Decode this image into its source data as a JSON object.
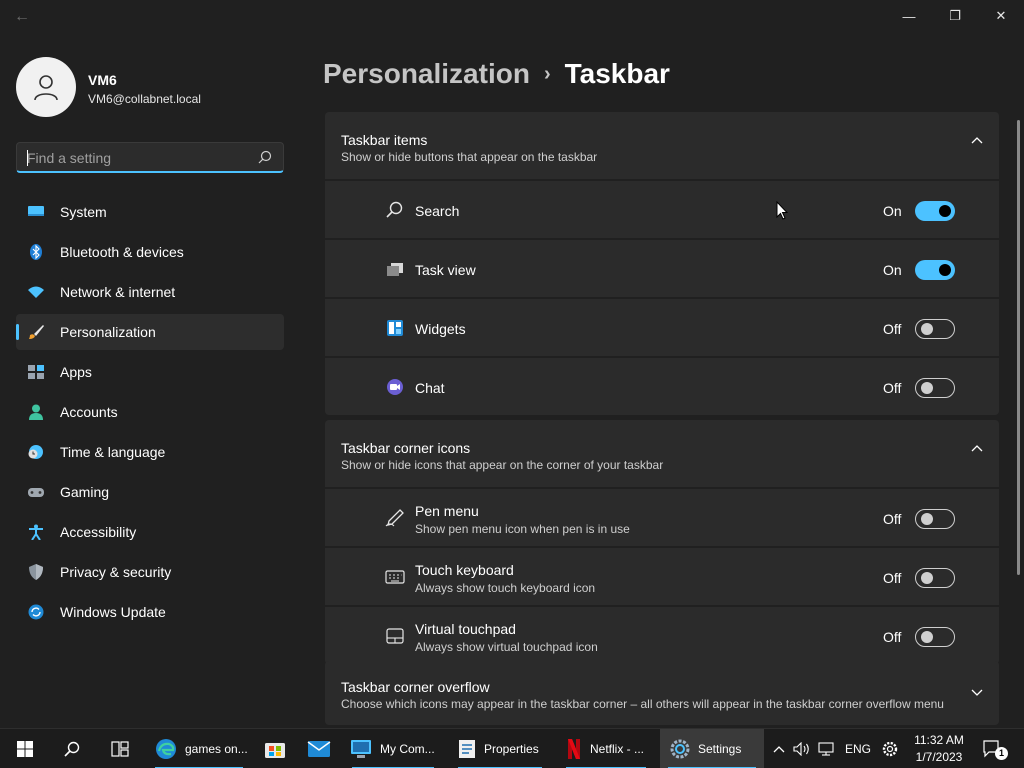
{
  "window": {
    "minimize_glyph": "—",
    "maximize_glyph": "❐",
    "close_glyph": "✕",
    "back_glyph": "←"
  },
  "user": {
    "name": "VM6",
    "email": "VM6@collabnet.local"
  },
  "search": {
    "placeholder": "Find a setting",
    "value": ""
  },
  "sidebar": {
    "items": [
      {
        "label": "System",
        "icon": "monitor-icon",
        "active": false
      },
      {
        "label": "Bluetooth & devices",
        "icon": "bluetooth-icon",
        "active": false
      },
      {
        "label": "Network & internet",
        "icon": "wifi-icon",
        "active": false
      },
      {
        "label": "Personalization",
        "icon": "brush-icon",
        "active": true
      },
      {
        "label": "Apps",
        "icon": "apps-icon",
        "active": false
      },
      {
        "label": "Accounts",
        "icon": "person-icon",
        "active": false
      },
      {
        "label": "Time & language",
        "icon": "clock-globe-icon",
        "active": false
      },
      {
        "label": "Gaming",
        "icon": "gamepad-icon",
        "active": false
      },
      {
        "label": "Accessibility",
        "icon": "accessibility-icon",
        "active": false
      },
      {
        "label": "Privacy & security",
        "icon": "shield-icon",
        "active": false
      },
      {
        "label": "Windows Update",
        "icon": "update-icon",
        "active": false
      }
    ]
  },
  "breadcrumb": {
    "parent": "Personalization",
    "separator": "›",
    "current": "Taskbar"
  },
  "sections": {
    "taskbar_items": {
      "title": "Taskbar items",
      "description": "Show or hide buttons that appear on the taskbar",
      "rows": [
        {
          "label": "Search",
          "state": "On",
          "on": true,
          "icon": "search-icon"
        },
        {
          "label": "Task view",
          "state": "On",
          "on": true,
          "icon": "task-view-icon"
        },
        {
          "label": "Widgets",
          "state": "Off",
          "on": false,
          "icon": "widgets-icon"
        },
        {
          "label": "Chat",
          "state": "Off",
          "on": false,
          "icon": "chat-icon"
        }
      ]
    },
    "corner_icons": {
      "title": "Taskbar corner icons",
      "description": "Show or hide icons that appear on the corner of your taskbar",
      "rows": [
        {
          "label": "Pen menu",
          "sub": "Show pen menu icon when pen is in use",
          "state": "Off",
          "on": false,
          "icon": "pen-icon"
        },
        {
          "label": "Touch keyboard",
          "sub": "Always show touch keyboard icon",
          "state": "Off",
          "on": false,
          "icon": "keyboard-icon"
        },
        {
          "label": "Virtual touchpad",
          "sub": "Always show virtual touchpad icon",
          "state": "Off",
          "on": false,
          "icon": "touchpad-icon"
        }
      ]
    },
    "corner_overflow": {
      "title": "Taskbar corner overflow",
      "description": "Choose which icons may appear in the taskbar corner – all others will appear in the taskbar corner overflow menu"
    }
  },
  "taskbar": {
    "apps": [
      {
        "label": "games on...",
        "icon": "edge-icon"
      },
      {
        "label": "My Com...",
        "icon": "computer-icon"
      },
      {
        "label": "Properties",
        "icon": "properties-icon"
      },
      {
        "label": "Netflix - ...",
        "icon": "netflix-icon"
      },
      {
        "label": "Settings",
        "icon": "settings-icon",
        "active": true
      }
    ],
    "language": "ENG",
    "time": "11:32 AM",
    "date": "1/7/2023",
    "notification_count": "1"
  },
  "colors": {
    "accent": "#4cc2ff",
    "background": "#202020",
    "card": "#2b2b2b"
  }
}
